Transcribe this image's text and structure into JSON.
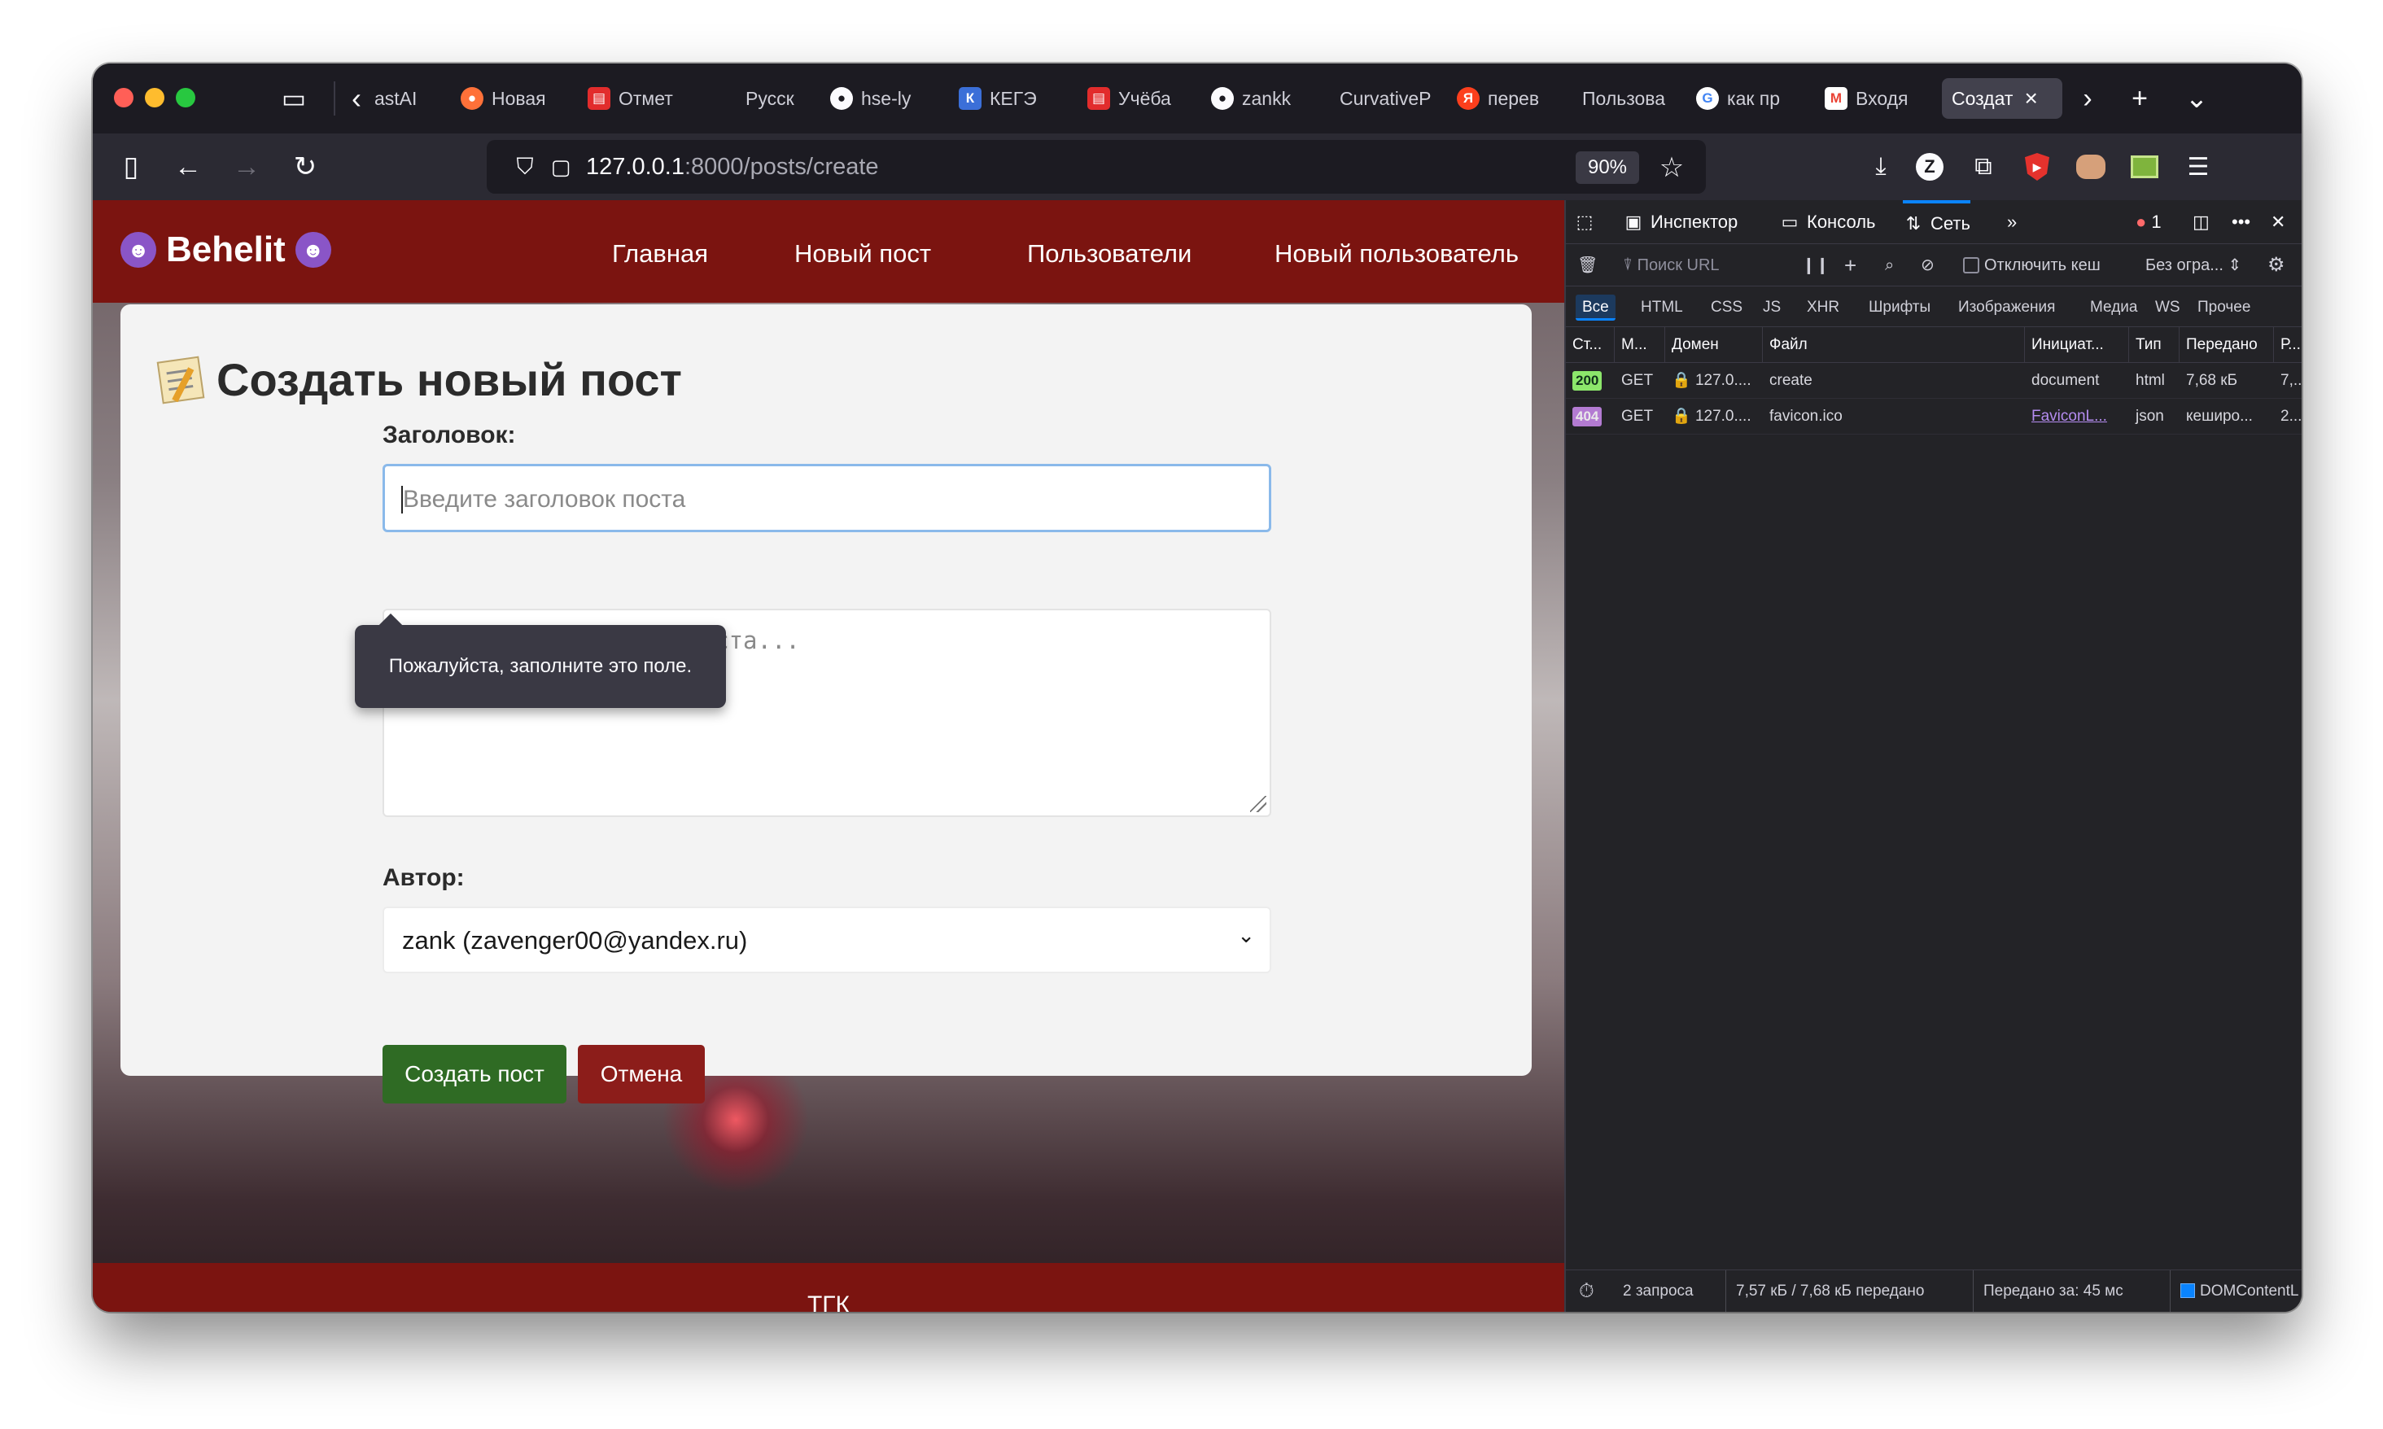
{
  "browser": {
    "tabs": [
      {
        "label": "astAI",
        "favicon": "none"
      },
      {
        "label": "Новая",
        "favicon": "firefox-icon",
        "color": "#ff7139"
      },
      {
        "label": "Отмет",
        "favicon": "doc-icon",
        "color": "#e22c2c"
      },
      {
        "label": "Русск",
        "favicon": "none"
      },
      {
        "label": "hse-ly",
        "favicon": "github-icon",
        "color": "#fbfbfe"
      },
      {
        "label": "КЕГЭ",
        "favicon": "kege-icon",
        "color": "#3b6fd8"
      },
      {
        "label": "Учёба",
        "favicon": "doc-icon",
        "color": "#e22c2c"
      },
      {
        "label": "zankk",
        "favicon": "github-icon",
        "color": "#fbfbfe"
      },
      {
        "label": "CurvativeP",
        "favicon": "none"
      },
      {
        "label": "перев",
        "favicon": "yandex-icon",
        "color": "#fc3f1d"
      },
      {
        "label": "Пользова",
        "favicon": "none"
      },
      {
        "label": "как пр",
        "favicon": "google-icon",
        "color": "#4285f4"
      },
      {
        "label": "Входя",
        "favicon": "gmail-icon",
        "color": "#ea4335"
      },
      {
        "label": "Создат",
        "favicon": "none",
        "active": true
      }
    ],
    "url_host": "127.0.0.1",
    "url_path": ":8000/posts/create",
    "zoom": "90%"
  },
  "site": {
    "logo": "Behelit",
    "nav": [
      "Главная",
      "Новый пост",
      "Пользователи",
      "Новый пользователь"
    ],
    "footer": "ТГК"
  },
  "form": {
    "title": "Создать новый пост",
    "title_label": "Заголовок:",
    "title_placeholder": "Введите заголовок поста",
    "tooltip": "Пожалуйста, заполните это поле.",
    "content_placeholder": "Напишите содержание поста...",
    "author_label": "Автор:",
    "author_value": "zank (zavenger00@yandex.ru)",
    "submit_label": "Создать пост",
    "cancel_label": "Отмена"
  },
  "devtools": {
    "tabs": [
      "Инспектор",
      "Консоль",
      "Сеть"
    ],
    "error_count": "1",
    "filter_placeholder": "Поиск URL",
    "disable_cache_label": "Отключить кеш",
    "throttle_label": "Без огра...",
    "type_filters": [
      "Все",
      "HTML",
      "CSS",
      "JS",
      "XHR",
      "Шрифты",
      "Изображения",
      "Медиа",
      "WS",
      "Прочее"
    ],
    "columns": [
      "Ст...",
      "М...",
      "Домен",
      "Файл",
      "Инициат...",
      "Тип",
      "Передано",
      "Р..."
    ],
    "rows": [
      {
        "status": "200",
        "method": "GET",
        "domain": "127.0....",
        "file": "create",
        "initiator": "document",
        "type": "html",
        "transferred": "7,68 кБ",
        "size": "7,..."
      },
      {
        "status": "404",
        "method": "GET",
        "domain": "127.0....",
        "file": "favicon.ico",
        "initiator": "FaviconL...",
        "type": "json",
        "transferred": "кеширо...",
        "size": "2..."
      }
    ],
    "status_requests": "2 запроса",
    "status_size": "7,57 кБ / 7,68 кБ передано",
    "status_time": "Передано за: 45 мс",
    "status_dom": "DOMContentL"
  }
}
